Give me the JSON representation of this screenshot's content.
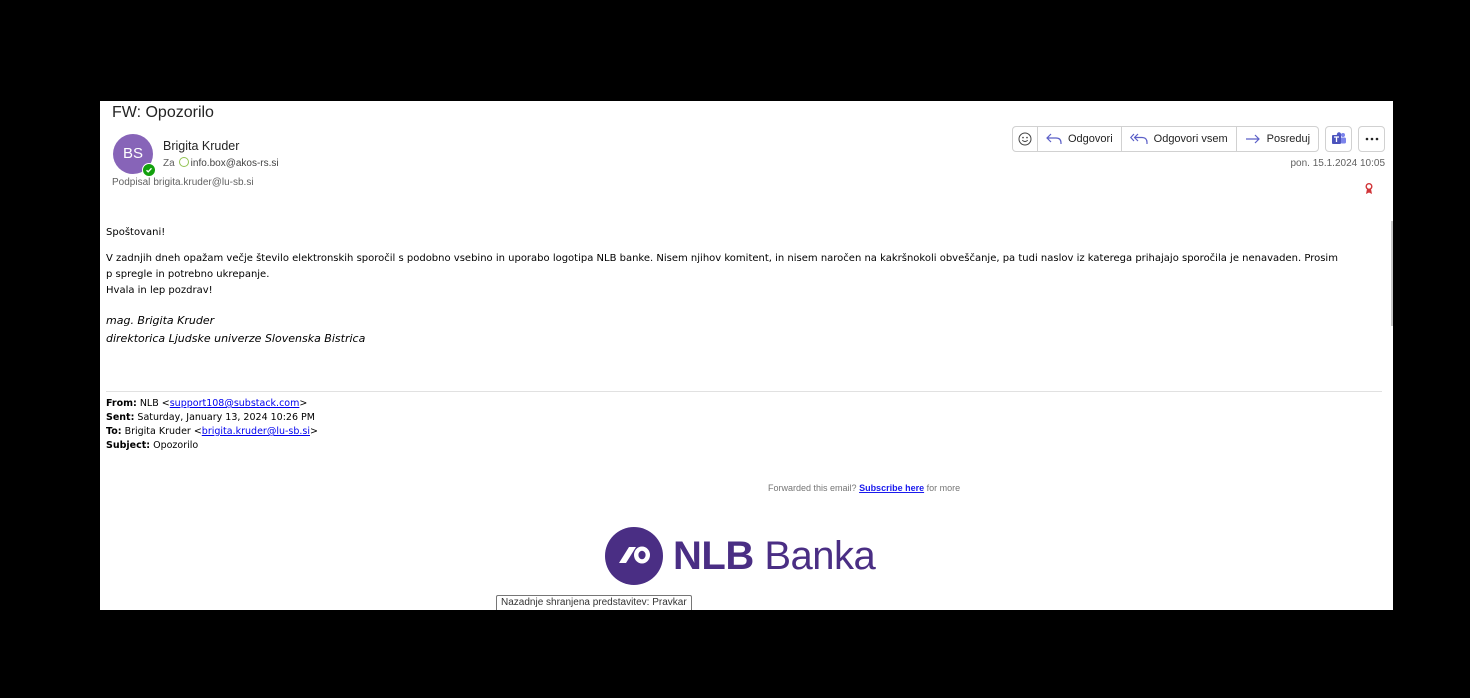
{
  "email": {
    "subject": "FW: Opozorilo",
    "avatar_initials": "BS",
    "sender_name": "Brigita Kruder",
    "to_label": "Za",
    "to_address": "info.box@akos-rs.si",
    "signed_label": "Podpisal",
    "signed_address": "brigita.kruder@lu-sb.si",
    "date": "pon. 15.1.2024 10:05"
  },
  "actions": {
    "reply": "Odgovori",
    "reply_all": "Odgovori vsem",
    "forward": "Posreduj"
  },
  "icons": {
    "emoji": "smiley-icon",
    "reply": "reply-arrow-icon",
    "reply_all": "reply-all-arrow-icon",
    "forward": "forward-arrow-icon",
    "teams": "teams-icon",
    "more": "more-ellipsis-icon",
    "signature_badge": "signature-ribbon-icon"
  },
  "colors": {
    "avatar": "#8764b8",
    "presence": "#13a10e",
    "nlb_purple": "#4a2e84",
    "link": "#0000ee",
    "badge": "#d13438"
  },
  "body": {
    "greeting": "Spoštovani!",
    "paragraph_1": "V zadnjih dneh opažam večje število elektronskih sporočil s podobno vsebino in uporabo logotipa NLB banke. Nisem njihov komitent, in nisem naročen na kakršnokoli obveščanje, pa tudi naslov iz katerega prihajajo sporočila je nenavaden. Prosim",
    "paragraph_2": "p spregle in  potrebno ukrepanje.",
    "closing": "Hvala in lep pozdrav!",
    "signature_name": "mag. Brigita Kruder",
    "signature_title": "direktorica Ljudske univerze Slovenska Bistrica"
  },
  "forwarded": {
    "from_label": "From:",
    "from_name": "NLB <",
    "from_email": "support108@substack.com",
    "from_close": ">",
    "sent_label": "Sent:",
    "sent_value": "Saturday, January 13, 2024 10:26 PM",
    "to_label": "To:",
    "to_name": "Brigita Kruder <",
    "to_email": "brigita.kruder@lu-sb.si",
    "to_close": ">",
    "subject_label": "Subject:",
    "subject_value": "Opozorilo"
  },
  "promo": {
    "prefix": "Forwarded this email?",
    "link": "Subscribe here",
    "suffix": "for more"
  },
  "logo": {
    "bold": "NLB",
    "regular": " Banka"
  },
  "tooltip": "Nazadnje shranjena predstavitev: Pravkar"
}
